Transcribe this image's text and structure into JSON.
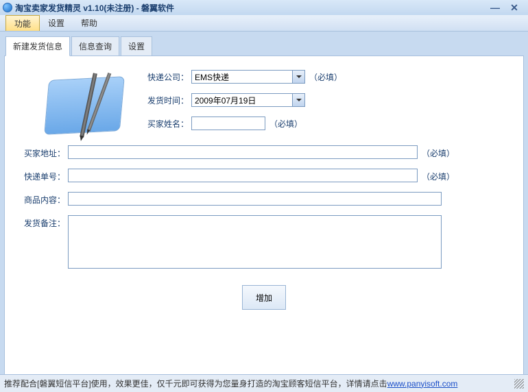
{
  "window": {
    "title": "淘宝卖家发货精灵  v1.10(未注册) - 磐翼软件"
  },
  "menu": {
    "items": [
      {
        "label": "功能",
        "active": true
      },
      {
        "label": "设置",
        "active": false
      },
      {
        "label": "帮助",
        "active": false
      }
    ]
  },
  "tabs": [
    {
      "label": "新建发货信息",
      "active": true
    },
    {
      "label": "信息查询",
      "active": false
    },
    {
      "label": "设置",
      "active": false
    }
  ],
  "form": {
    "courier_label": "快递公司：",
    "courier_value": "EMS快递",
    "courier_hint": "（必填）",
    "ship_date_label": "发货时间：",
    "ship_date_value": "2009年07月19日",
    "buyer_name_label": "买家姓名：",
    "buyer_name_value": "",
    "buyer_name_hint": "（必填）",
    "buyer_addr_label": "买家地址：",
    "buyer_addr_value": "",
    "buyer_addr_hint": "（必填）",
    "tracking_label": "快递单号：",
    "tracking_value": "",
    "tracking_hint": "（必填）",
    "goods_label": "商品内容：",
    "goods_value": "",
    "remark_label": "发货备注：",
    "remark_value": "",
    "add_button": "增加"
  },
  "footer": {
    "text": "推荐配合[磐翼短信平台]使用，效果更佳，仅千元即可获得为您量身打造的淘宝顾客短信平台，详情请点击 ",
    "link_text": "www.panyisoft.com"
  }
}
